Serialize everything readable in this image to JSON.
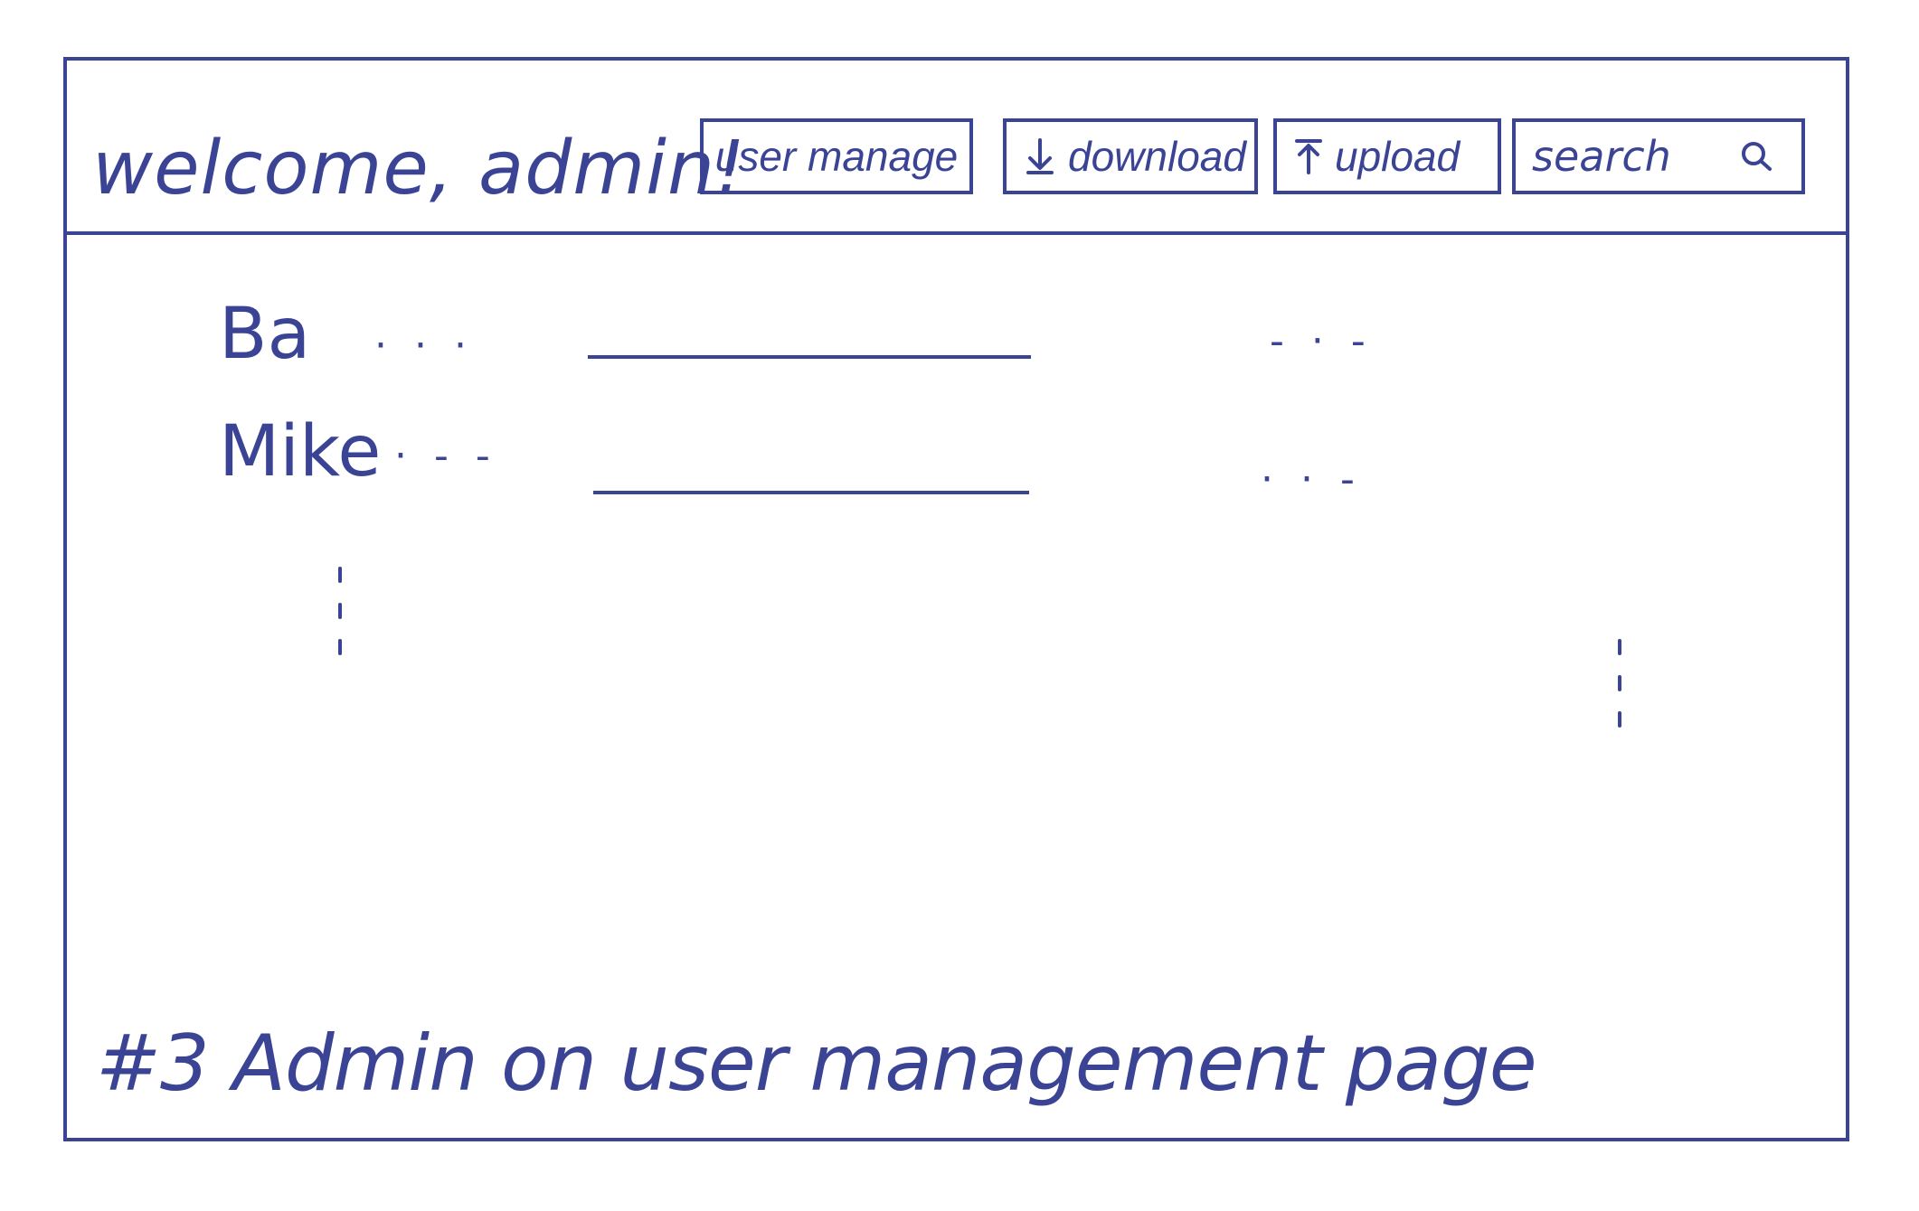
{
  "header": {
    "welcome": "welcome, admin!",
    "buttons": {
      "user_manage": "user manage",
      "download": "download",
      "upload": "upload"
    },
    "search": {
      "placeholder": "search",
      "icon": "search-icon"
    }
  },
  "users": [
    {
      "name": "Ba",
      "info": "· · ·",
      "extra": "- · -"
    },
    {
      "name": "Mike",
      "info": "· - -",
      "extra": "· · -"
    }
  ],
  "caption": "#3 Admin on user management page",
  "colors": {
    "ink": "#3b4494",
    "background": "#ffffff"
  }
}
